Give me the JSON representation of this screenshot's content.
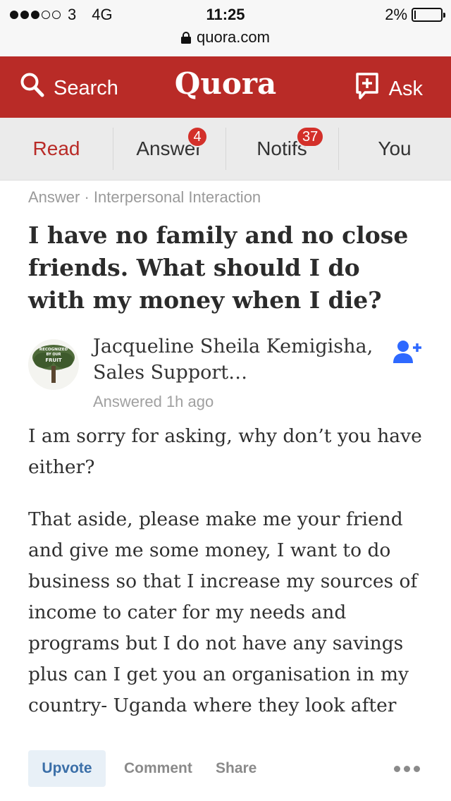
{
  "status_bar": {
    "carrier": "3",
    "network": "4G",
    "time": "11:25",
    "battery": "2%",
    "url": "quora.com"
  },
  "header": {
    "search_label": "Search",
    "logo": "Quora",
    "ask_label": "Ask",
    "color": "#b92b27"
  },
  "tabs": [
    {
      "label": "Read",
      "badge": null
    },
    {
      "label": "Answer",
      "badge": "4"
    },
    {
      "label": "Notifs",
      "badge": "37"
    },
    {
      "label": "You",
      "badge": null
    }
  ],
  "answer": {
    "breadcrumb": "Answer · Interpersonal Interaction",
    "question": "I have no family and no close friends. What should I do with my money when I die?",
    "author_name": "Jacqueline Sheila Kemigisha, Sales Support…",
    "answered_time": "Answered 1h ago",
    "avatar_text": [
      "RECOGNIZED",
      "BY OUR",
      "FRUIT"
    ],
    "paragraphs": [
      "I am sorry for asking, why don’t you have either?",
      "That aside, please make me your friend and give me some money, I want to do business so that I increase my sources of income to cater for my needs and programs but I do not have any savings plus can I get you an organisation in my country- Uganda where they look after"
    ]
  },
  "actions": {
    "upvote": "Upvote",
    "comment": "Comment",
    "share": "Share"
  }
}
